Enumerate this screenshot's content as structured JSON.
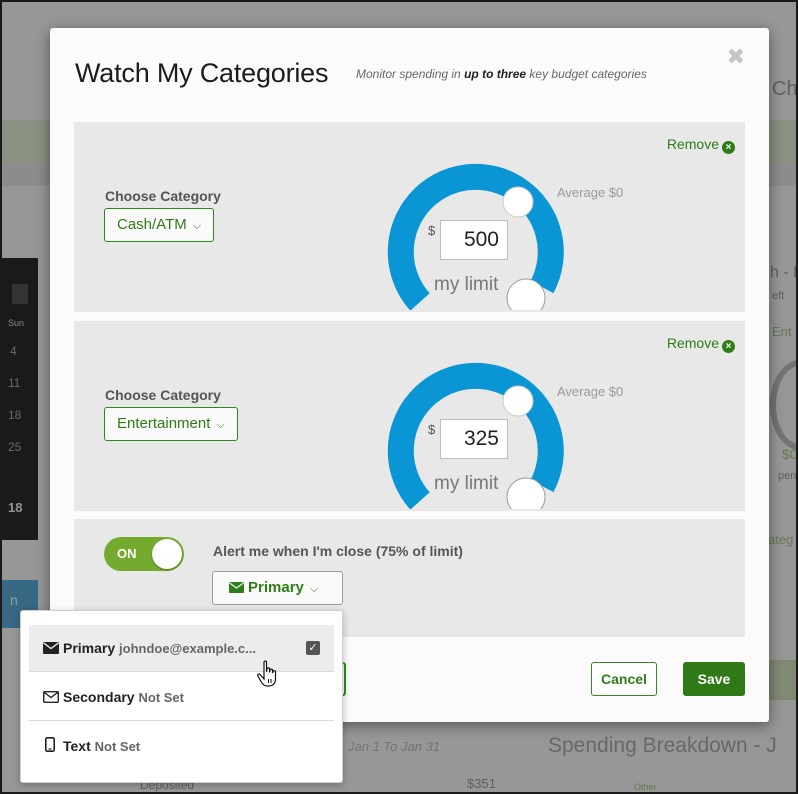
{
  "modal": {
    "title": "Watch My Categories",
    "subtitle_pre": "Monitor spending in ",
    "subtitle_bold": "up to three",
    "subtitle_post": " key budget categories",
    "close_glyph": "✖"
  },
  "categories": [
    {
      "remove_label": "Remove",
      "choose_label": "Choose Category",
      "selected": "Cash/ATM",
      "average_label": "Average $0",
      "currency": "$",
      "limit_value": "500",
      "limit_caption": "my limit",
      "gauge_fill_fraction": 1.0
    },
    {
      "remove_label": "Remove",
      "choose_label": "Choose Category",
      "selected": "Entertainment",
      "average_label": "Average $0",
      "currency": "$",
      "limit_value": "325",
      "limit_caption": "my limit",
      "gauge_fill_fraction": 1.0
    }
  ],
  "alert": {
    "toggle_label": "ON",
    "toggle_state": "on",
    "label": "Alert me when I'm close (75% of limit)",
    "method_selected": "Primary"
  },
  "dropdown": {
    "items": [
      {
        "label": "Primary",
        "detail": "johndoe@example.c...",
        "icon": "envelope-filled-icon",
        "checked": true
      },
      {
        "label": "Secondary",
        "detail": "Not Set",
        "icon": "envelope-outline-icon",
        "checked": false
      },
      {
        "label": "Text",
        "detail": "Not Set",
        "icon": "mobile-phone-icon",
        "checked": false
      }
    ]
  },
  "footer": {
    "cancel_label": "Cancel",
    "save_label": "Save"
  },
  "background": {
    "top_right_fragment": "Ch",
    "mid_right_fragment": "h - F",
    "mid_right_fragment2": "eft",
    "ent_fragment": "Ent",
    "dollar_fragment": "$0",
    "pen_fragment": "pen",
    "categ_fragment": "ateg",
    "calendar_header": "Sun",
    "calendar_days": [
      "4",
      "11",
      "18",
      "25"
    ],
    "left_num": "18",
    "left_letter": "n",
    "date_range": "Jan 1 To Jan 31",
    "breakdown_title": "Spending Breakdown - J",
    "deposited_label": "Deposited",
    "deposited_value": "$351",
    "other_label": "Other"
  },
  "colors": {
    "accent_green": "#2e7d16",
    "toggle_green": "#74ab2e",
    "gauge_blue": "#0a96d4",
    "panel_gray": "#e8e8e8"
  }
}
